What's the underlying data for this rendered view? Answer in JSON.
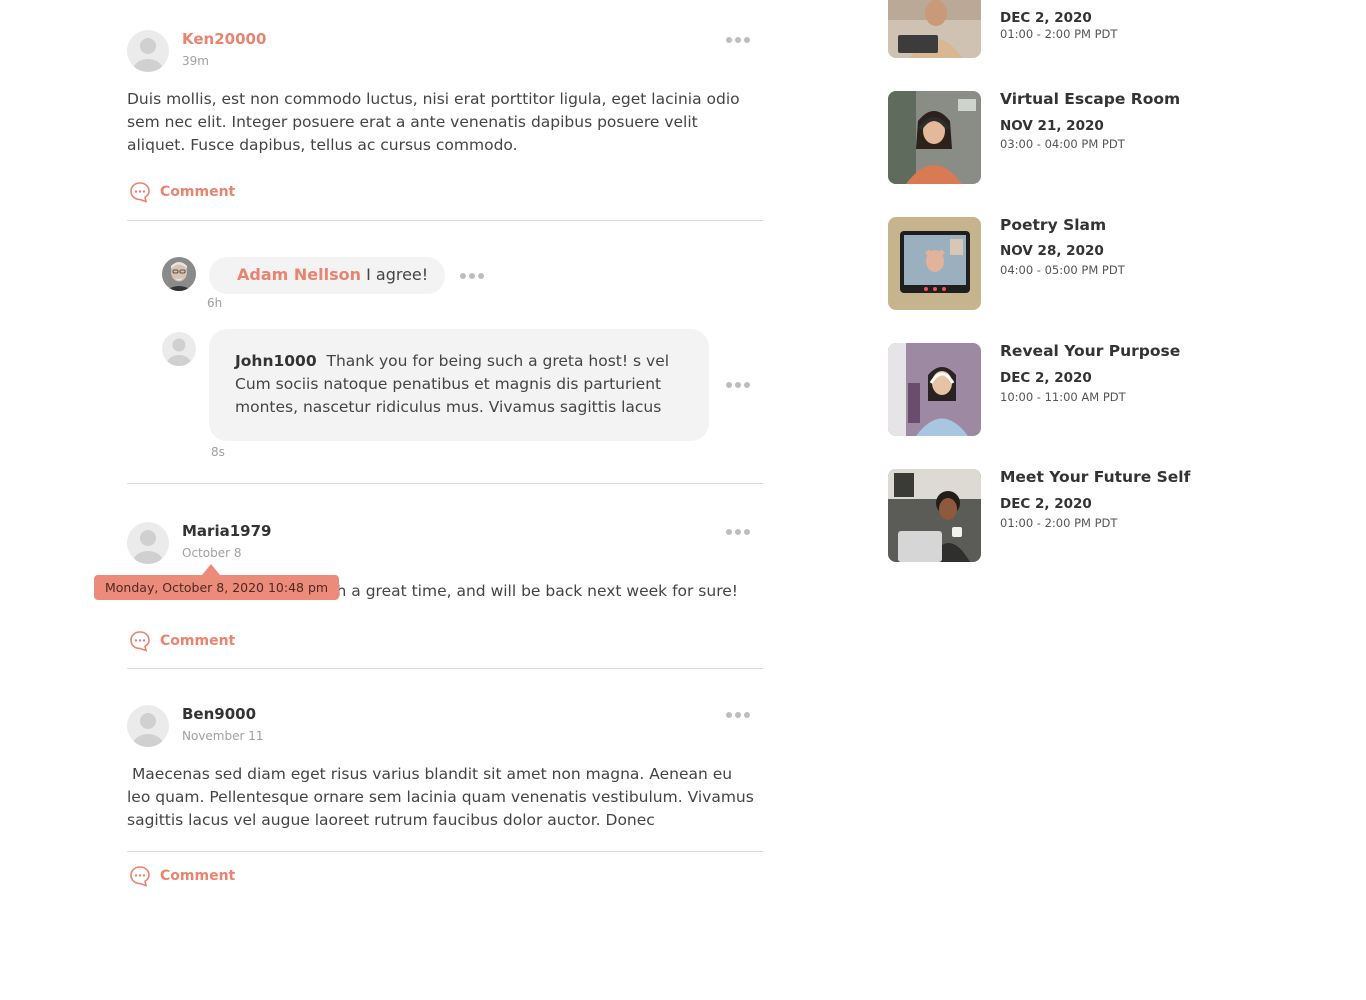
{
  "posts": [
    {
      "username": "Ken20000",
      "time": "39m",
      "text": "Duis mollis, est non commodo luctus, nisi erat porttitor ligula, eget lacinia odio sem nec elit. Integer posuere erat a ante venenatis dapibus posuere velit aliquet. Fusce dapibus, tellus ac cursus commodo.",
      "comment_label": "Comment",
      "replies": [
        {
          "username": "Adam Nellson",
          "text": "I agree!",
          "time": "6h"
        },
        {
          "username": "John1000",
          "text": "Thank you for being such a greta host! s vel Cum sociis natoque penatibus et magnis dis parturient montes, nascetur ridiculus mus. Vivamus sagittis lacus",
          "time": "8s"
        }
      ]
    },
    {
      "username": "Maria1979",
      "time": "October 8",
      "tooltip": "Monday, October 8, 2020 10:48 pm",
      "text": "ch a great time, and will be back next week for sure!",
      "comment_label": "Comment"
    },
    {
      "username": "Ben9000",
      "time": "November 11",
      "text": " Maecenas sed diam eget risus varius blandit sit amet non magna. Aenean eu leo quam. Pellentesque ornare sem lacinia quam venenatis vestibulum. Vivamus sagittis lacus vel augue laoreet rutrum faucibus dolor auctor. Donec",
      "comment_label": "Comment"
    }
  ],
  "events": [
    {
      "title": "",
      "date": "DEC 2, 2020",
      "time": "01:00 - 2:00 PM PDT"
    },
    {
      "title": "Virtual Escape Room",
      "date": "NOV 21, 2020",
      "time": "03:00 - 04:00 PM PDT"
    },
    {
      "title": "Poetry Slam",
      "date": "NOV 28, 2020",
      "time": "04:00 - 05:00 PM PDT"
    },
    {
      "title": "Reveal Your Purpose",
      "date": "DEC 2, 2020",
      "time": "10:00 - 11:00 AM PDT"
    },
    {
      "title": "Meet Your Future Self",
      "date": "DEC 2, 2020",
      "time": "01:00 - 2:00 PM PDT"
    }
  ],
  "colors": {
    "accent": "#e8846f",
    "tooltip_bg": "#ec8b7a",
    "bubble_bg": "#f3f3f3",
    "divider": "#dcdcdc",
    "more_dots": "#bdbdbd"
  },
  "icons": {
    "avatar": "avatar-placeholder-icon",
    "more": "more-horizontal-icon",
    "comment": "comment-bubble-icon"
  }
}
